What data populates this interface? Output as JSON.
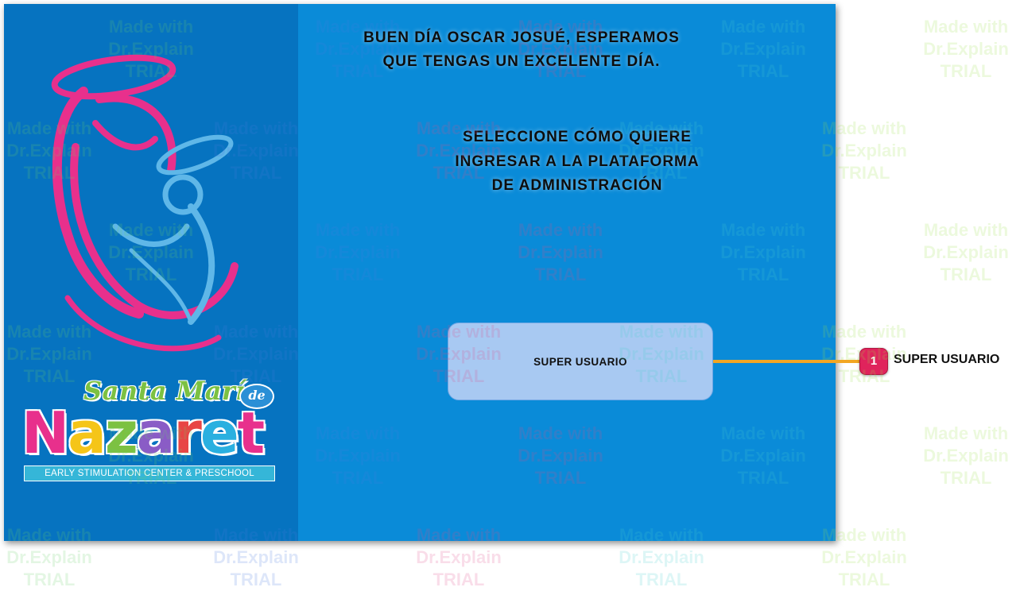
{
  "greeting": {
    "lines": [
      "BUEN DÍA OSCAR JOSUÉ, ESPERAMOS",
      "QUE TENGAS UN EXCELENTE DÍA."
    ]
  },
  "instruction": {
    "lines": [
      "SELECCIONE CÓMO QUIERE",
      "INGRESAR A LA PLATAFORMA",
      "DE ADMINISTRACIÓN"
    ]
  },
  "logo": {
    "name_top": "Santa María",
    "name_de": "de",
    "brand": "Nazaret",
    "tagline": "EARLY STIMULATION CENTER & PRESCHOOL",
    "colors": {
      "mother": "#e8308c",
      "child": "#5fb7e8",
      "green": "#7cc142"
    }
  },
  "super_user_button": {
    "label": "SUPER USUARIO"
  },
  "callout": {
    "number": "1",
    "label": "SUPER USUARIO",
    "line_color": "#f2a623",
    "marker_color": "#e0235c"
  },
  "watermark": {
    "lines": [
      "Made with",
      "Dr.Explain",
      "TRIAL"
    ]
  }
}
